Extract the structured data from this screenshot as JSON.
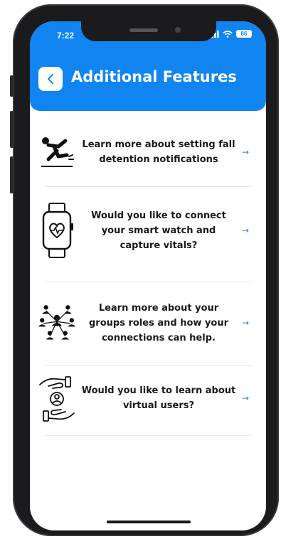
{
  "status_bar": {
    "time": "7:22",
    "battery": "86"
  },
  "header": {
    "title": "Additional Features"
  },
  "features": [
    {
      "text": "Learn more about setting fall detention notifications",
      "icon": "falling-person-icon"
    },
    {
      "text": "Would you like to connect your smart watch and capture vitals?",
      "icon": "smartwatch-heart-icon"
    },
    {
      "text": "Learn more about your groups roles and how your connections can help.",
      "icon": "group-network-icon"
    },
    {
      "text": "Would you like to learn about virtual users?",
      "icon": "hands-user-icon"
    }
  ],
  "colors": {
    "accent": "#1085f2",
    "text": "#1a1a1a",
    "divider": "#e3eaf2"
  }
}
